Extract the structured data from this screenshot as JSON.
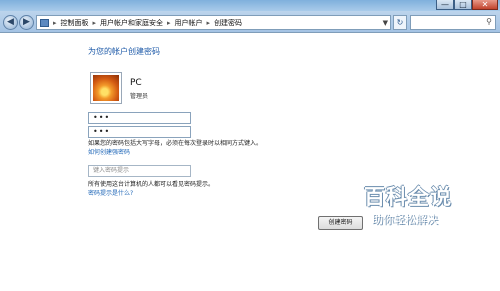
{
  "window": {
    "minimize": "—",
    "maximize": "□",
    "close": "✕"
  },
  "address": {
    "crumbs": [
      "控制面板",
      "用户帐户和家庭安全",
      "用户帐户",
      "创建密码"
    ],
    "separator": "▸",
    "search_placeholder": ""
  },
  "main": {
    "heading": "为您的帐户创建密码",
    "user_name": "PC",
    "user_role": "管理员",
    "password_mask": "•••",
    "confirm_mask": "•••",
    "case_note": "如果您的密码包括大写字母，必须在每次登录时以相同方式键入。",
    "create_strong_link": "如何创建强密码",
    "hint_placeholder": "键入密码提示",
    "hint_note": "所有使用这台计算机的人都可以看见密码提示。",
    "hint_link": "密码提示是什么?",
    "create_button": "创建密码"
  },
  "watermark": {
    "title": "百科全说",
    "subtitle": "助你轻松解决"
  },
  "colors": {
    "accent": "#1e5aa8",
    "link": "#1e66b7"
  }
}
